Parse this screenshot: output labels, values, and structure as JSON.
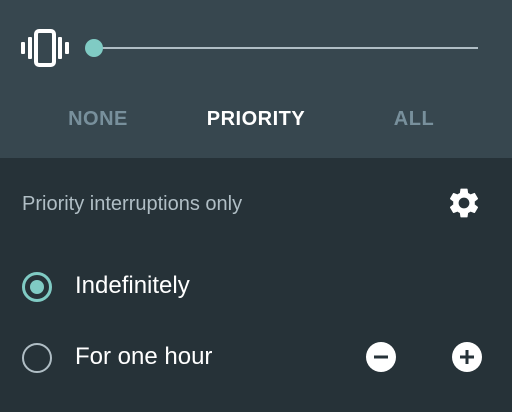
{
  "volume": {
    "icon": "vibrate-icon",
    "level_fraction": 0.0
  },
  "tabs": [
    {
      "label": "NONE",
      "active": false
    },
    {
      "label": "PRIORITY",
      "active": true
    },
    {
      "label": "ALL",
      "active": false
    }
  ],
  "priority_section": {
    "title": "Priority interruptions only",
    "settings_icon": "gear-icon"
  },
  "options": [
    {
      "label": "Indefinitely",
      "selected": true
    },
    {
      "label": "For one hour",
      "selected": false
    }
  ],
  "controls": {
    "decrease_icon": "minus-circle-icon",
    "increase_icon": "plus-circle-icon"
  },
  "colors": {
    "accent": "#80cbc4",
    "top_background": "#37474f",
    "background": "#263238",
    "inactive_text": "#78909c",
    "secondary_text": "#b0bec5"
  }
}
